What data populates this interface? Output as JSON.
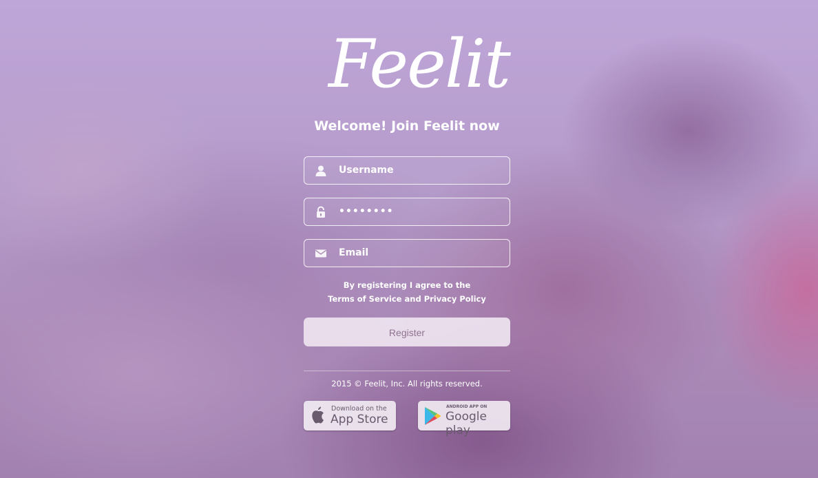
{
  "brand": {
    "logo_text": "Feelit"
  },
  "header": {
    "welcome": "Welcome! Join Feelit now"
  },
  "form": {
    "username_placeholder": "Username",
    "password_value": "••••••••",
    "email_placeholder": "Email",
    "terms_line1": "By registering I agree to the",
    "terms_link": "Terms of Service",
    "terms_and": "and",
    "privacy_link": "Privacy Policy",
    "register_label": "Register"
  },
  "footer": {
    "copyright": "2015 © Feelit, Inc. All rights reserved.",
    "app_store_small": "Download on the",
    "app_store_big": "App Store",
    "google_play_small": "ANDROID APP ON",
    "google_play_big": "Google play"
  },
  "colors": {
    "register_text": "#8f7390",
    "field_border": "#ffffff"
  }
}
